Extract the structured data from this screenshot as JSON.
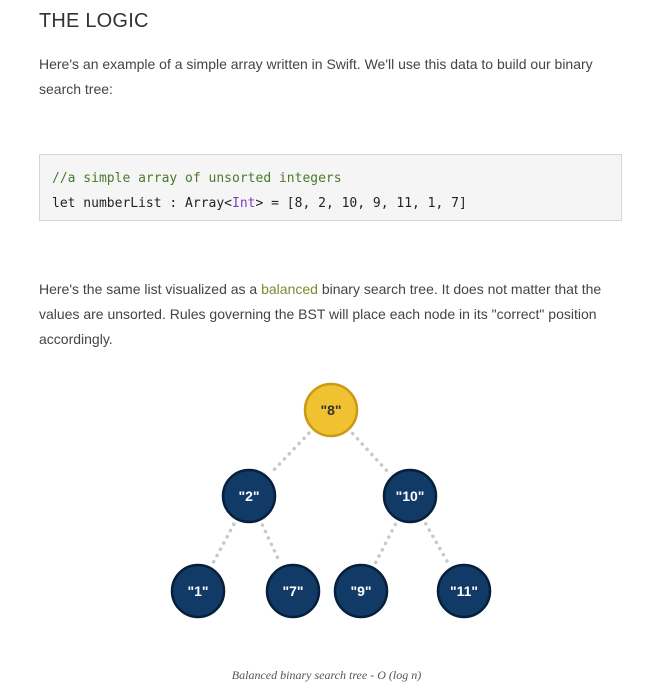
{
  "section": {
    "title": "THE LOGIC"
  },
  "intro": {
    "text": "Here's an example of a simple array written in Swift. We'll use this data to build our binary search tree:"
  },
  "code": {
    "comment": "//a simple array of unsorted integers",
    "line2_prefix": "let numberList : Array<",
    "line2_type": "Int",
    "line2_suffix": "> = [8, 2, 10, 9, 11, 1, 7]"
  },
  "description": {
    "before_link": "Here's the same list visualized as a ",
    "link_text": "balanced",
    "after_link": " binary search tree. It does not matter that the values are unsorted. Rules governing the BST will place each node in its \"correct\" position accordingly."
  },
  "tree": {
    "root_color": "#f0c232",
    "node_color": "#123a66",
    "edge_color": "#c8c8c8",
    "nodes": [
      {
        "id": "n8",
        "label": "\"8\"",
        "root": true
      },
      {
        "id": "n2",
        "label": "\"2\""
      },
      {
        "id": "n10",
        "label": "\"10\""
      },
      {
        "id": "n1",
        "label": "\"1\""
      },
      {
        "id": "n7",
        "label": "\"7\""
      },
      {
        "id": "n9",
        "label": "\"9\""
      },
      {
        "id": "n11",
        "label": "\"11\""
      }
    ],
    "edges": [
      [
        "n8",
        "n2"
      ],
      [
        "n8",
        "n10"
      ],
      [
        "n2",
        "n1"
      ],
      [
        "n2",
        "n7"
      ],
      [
        "n10",
        "n9"
      ],
      [
        "n10",
        "n11"
      ]
    ]
  },
  "caption": {
    "text": "Balanced binary search tree - O (log n)"
  }
}
